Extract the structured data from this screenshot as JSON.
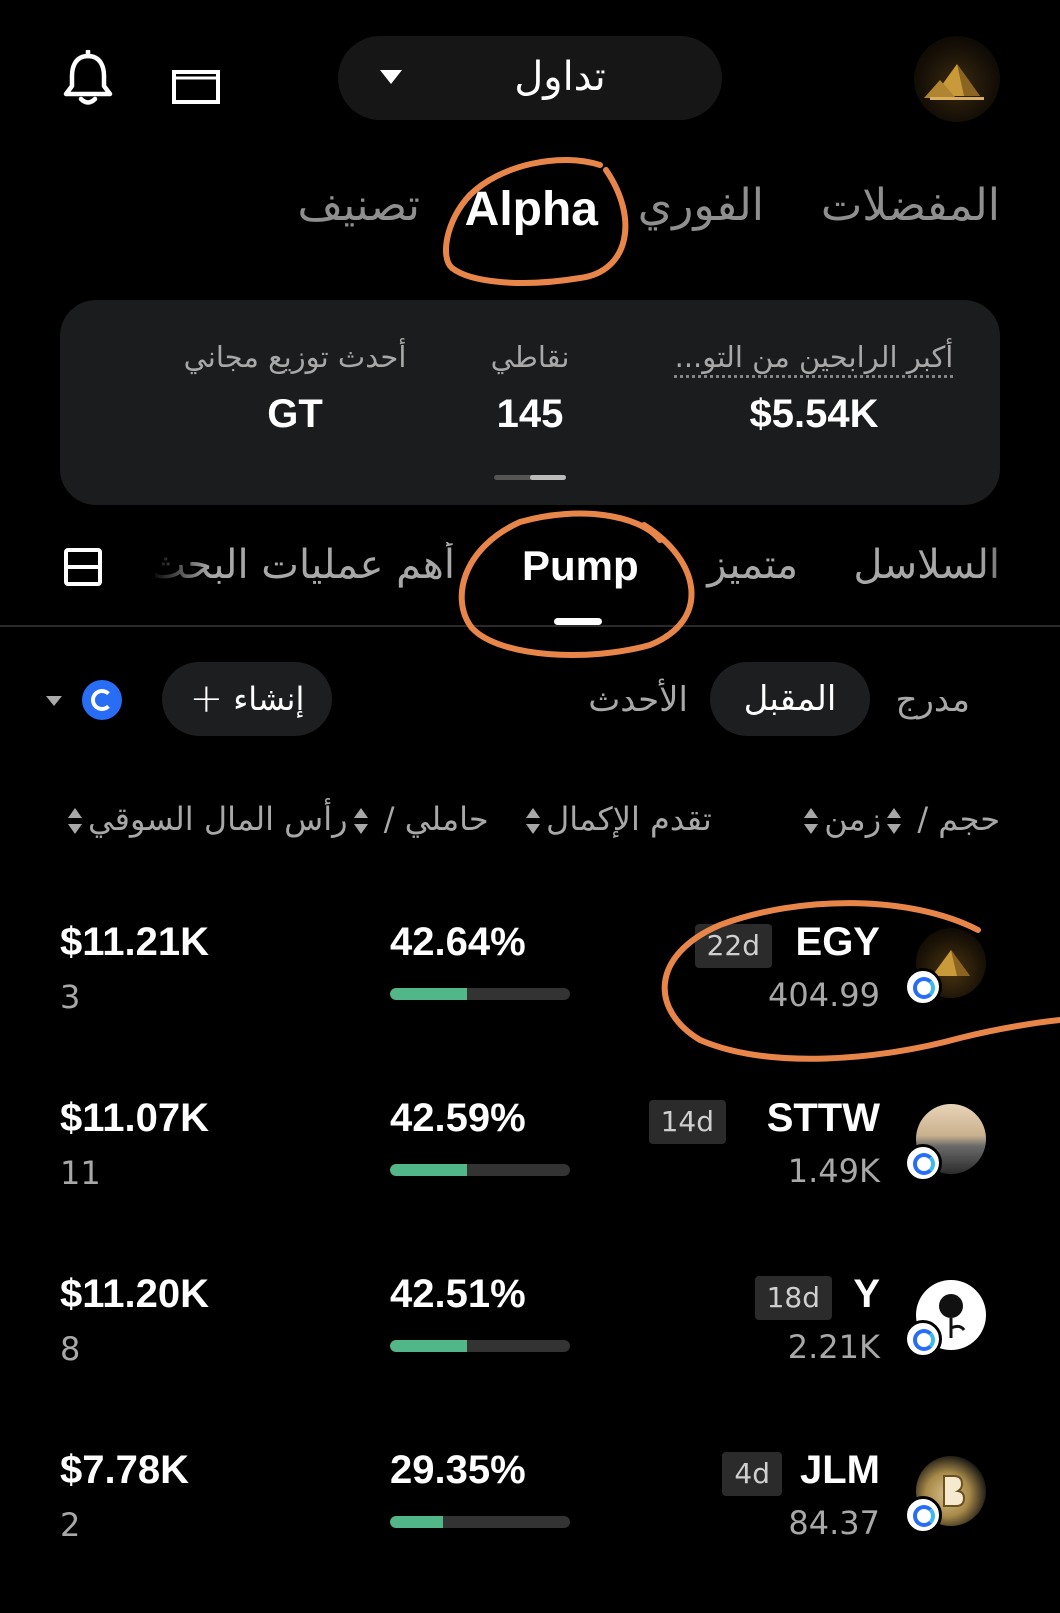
{
  "header": {
    "trade_label": "تداول",
    "icons": [
      "bell-icon",
      "wallet-icon",
      "caret-down-icon"
    ]
  },
  "main_tabs": {
    "favorites": "المفضلات",
    "spot": "الفوري",
    "alpha": "Alpha",
    "ranking": "تصنيف",
    "active": "Alpha"
  },
  "stats_card": {
    "top_winners_label": "أكبر الرابحين من التو...",
    "top_winners_value": "$5.54K",
    "points_label": "نقاطي",
    "points_value": "145",
    "airdrop_label": "أحدث توزيع مجاني",
    "airdrop_value": "GT"
  },
  "sub_tabs": {
    "chains": "السلاسل",
    "distinct": "متميز",
    "pump": "Pump",
    "top_search": "أهم عمليات البحث",
    "active": "Pump"
  },
  "filters": {
    "listed": "مدرج",
    "upcoming": "المقبل",
    "latest": "الأحدث",
    "create": "إنشاء",
    "active": "المقبل"
  },
  "columns": {
    "time": "زمن",
    "volume": "حجم",
    "progress": "تقدم الإكمال",
    "market_cap": "رأس المال السوقي",
    "holders": "حاملي"
  },
  "rows": [
    {
      "symbol": "EGY",
      "age": "22d",
      "volume": "404.99",
      "progress": "42.64%",
      "progress_value": 0.4264,
      "market_cap": "$11.21K",
      "holders": "3"
    },
    {
      "symbol": "STTW",
      "age": "14d",
      "volume": "1.49K",
      "progress": "42.59%",
      "progress_value": 0.4259,
      "market_cap": "$11.07K",
      "holders": "11"
    },
    {
      "symbol": "Y",
      "age": "18d",
      "volume": "2.21K",
      "progress": "42.51%",
      "progress_value": 0.4251,
      "market_cap": "$11.20K",
      "holders": "8"
    },
    {
      "symbol": "JLM",
      "age": "4d",
      "volume": "84.37",
      "progress": "29.35%",
      "progress_value": 0.2935,
      "market_cap": "$7.78K",
      "holders": "2"
    }
  ],
  "colors": {
    "background": "#000000",
    "card": "#1b1c1e",
    "progress_fill": "#52b788",
    "annotation": "#e8864a"
  }
}
